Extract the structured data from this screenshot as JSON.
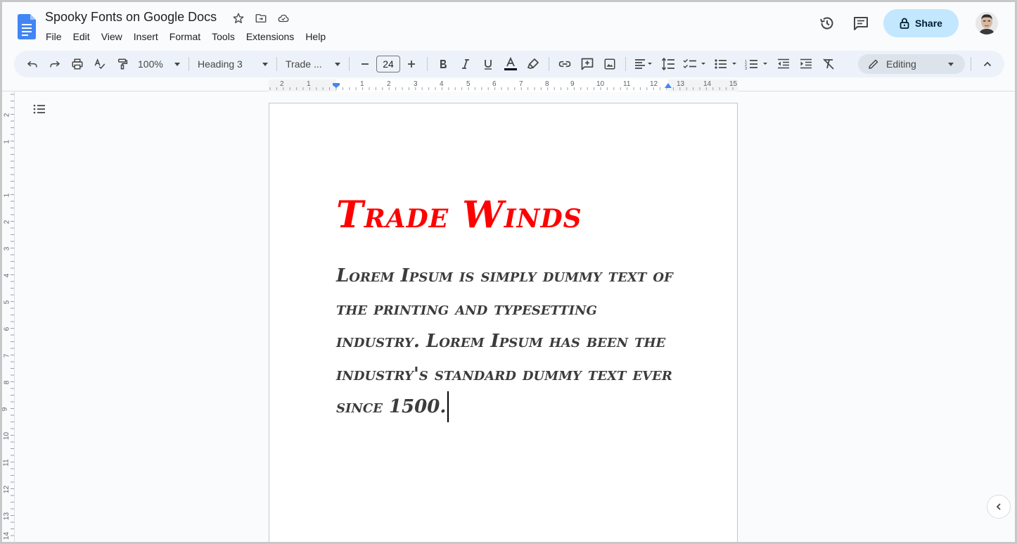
{
  "document": {
    "title": "Spooky Fonts on Google Docs"
  },
  "menu": {
    "items": [
      {
        "label": "File"
      },
      {
        "label": "Edit"
      },
      {
        "label": "View"
      },
      {
        "label": "Insert"
      },
      {
        "label": "Format"
      },
      {
        "label": "Tools"
      },
      {
        "label": "Extensions"
      },
      {
        "label": "Help"
      }
    ]
  },
  "header": {
    "share_label": "Share"
  },
  "toolbar": {
    "zoom": "100%",
    "style": "Heading 3",
    "font": "Trade ...",
    "font_size": "24",
    "mode": "Editing"
  },
  "ruler": {
    "horizontal": [
      "2",
      "1",
      "1",
      "2",
      "3",
      "4",
      "5",
      "6",
      "7",
      "8",
      "9",
      "10",
      "11",
      "12",
      "13",
      "14",
      "15"
    ],
    "vertical": [
      "2",
      "1",
      "1",
      "2",
      "3",
      "4",
      "5",
      "6",
      "7",
      "8",
      "9",
      "10",
      "11",
      "12",
      "13",
      "14"
    ]
  },
  "content": {
    "heading": "Trade Winds",
    "body": "Lorem Ipsum is simply dummy text of the printing and typesetting industry. Lorem Ipsum has been the industry's standard dummy text ever since 1500."
  },
  "colors": {
    "heading": "#ff0000",
    "body": "#3c3c3c",
    "share_bg": "#c2e7ff",
    "toolbar_bg": "#edf2fa",
    "docs_blue": "#4285f4"
  },
  "icons": {
    "title": [
      "star-icon",
      "move-folder-icon",
      "cloud-saved-icon"
    ],
    "header": [
      "history-icon",
      "comments-icon",
      "lock-icon"
    ]
  }
}
